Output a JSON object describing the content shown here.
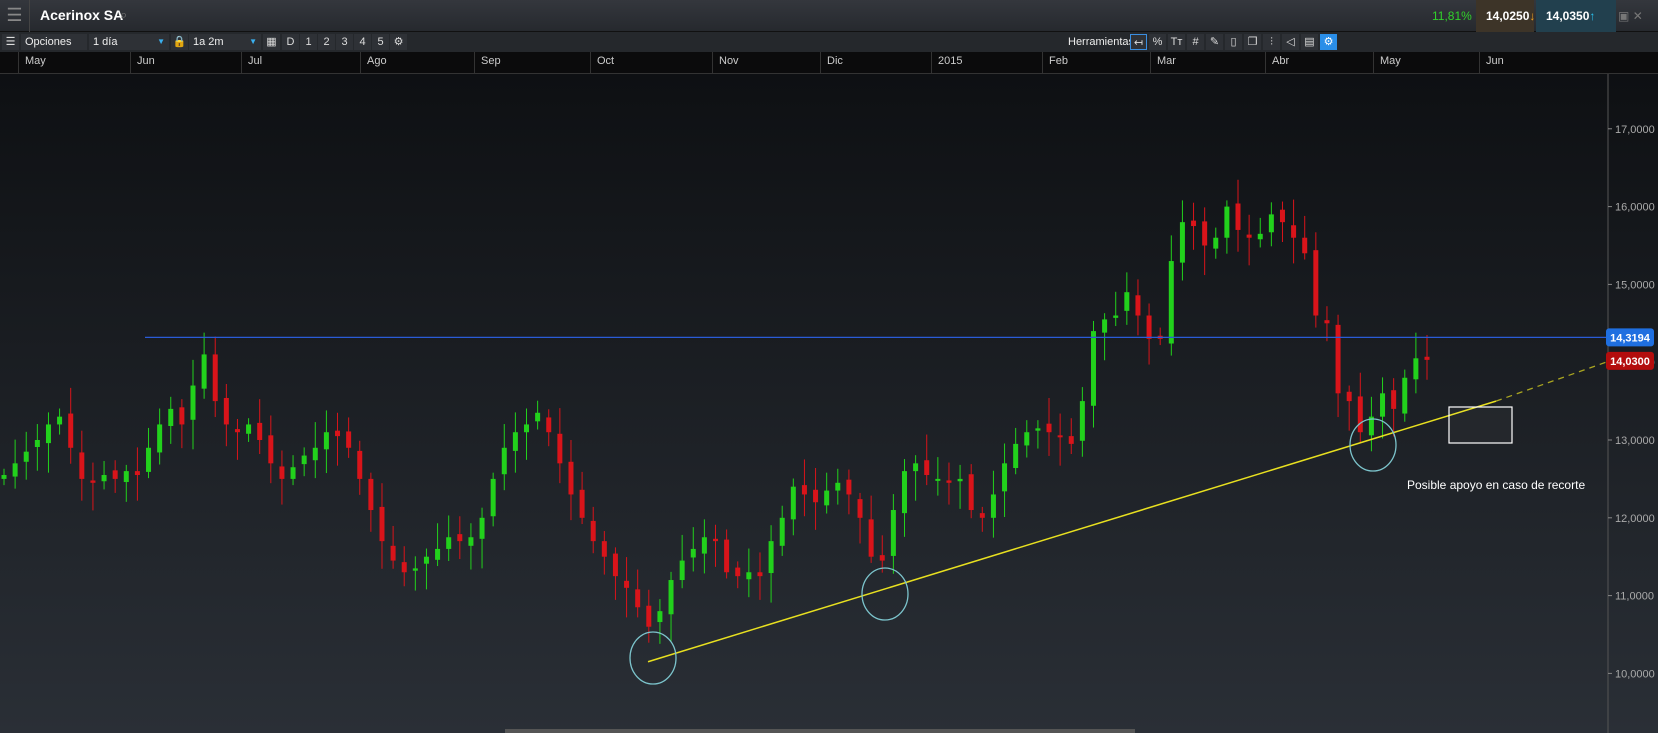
{
  "window": {
    "title": "Acerinox SA",
    "change_pct": "11,81%",
    "bid": "14,0250",
    "ask": "14,0350",
    "icons": [
      "menu-icon",
      "search-icon",
      "bid-down-arrow-icon",
      "ask-up-arrow-icon",
      "restore-icon",
      "close-icon"
    ]
  },
  "toolbar": {
    "options_label": "Opciones",
    "interval": "1 día",
    "range": "1a 2m",
    "periods": [
      "D",
      "1",
      "2",
      "3",
      "4",
      "5"
    ],
    "tools_label": "Herramientas",
    "tool_icons": [
      "back-icon",
      "%",
      "Tт",
      "#",
      "draw-icon",
      "candle-icon",
      "windows-icon",
      "candles-icon",
      "tag-icon",
      "print-icon",
      "settings-draw-icon"
    ]
  },
  "chart_data": {
    "type": "candlestick",
    "x_ticks": [
      "May",
      "Jun",
      "Jul",
      "Ago",
      "Sep",
      "Oct",
      "Nov",
      "Dic",
      "2015",
      "Feb",
      "Mar",
      "Abr",
      "May",
      "Jun"
    ],
    "y_ticks": [
      "10,0000",
      "11,0000",
      "12,0000",
      "13,0000",
      "14,0000",
      "15,0000",
      "16,0000",
      "17,0000"
    ],
    "ylim": [
      9.5,
      18.3
    ],
    "closes": [
      12.55,
      12.7,
      12.85,
      13.0,
      13.2,
      13.3,
      12.9,
      12.5,
      12.45,
      12.55,
      12.5,
      12.6,
      12.55,
      12.9,
      13.2,
      13.4,
      13.2,
      13.7,
      14.1,
      13.5,
      13.2,
      13.1,
      13.2,
      13.0,
      12.7,
      12.5,
      12.65,
      12.8,
      12.9,
      13.1,
      13.05,
      12.9,
      12.5,
      12.1,
      11.7,
      11.45,
      11.3,
      11.35,
      11.5,
      11.6,
      11.75,
      11.7,
      11.75,
      12.0,
      12.5,
      12.9,
      13.1,
      13.2,
      13.35,
      13.1,
      12.7,
      12.3,
      12.0,
      11.7,
      11.5,
      11.25,
      11.1,
      10.85,
      10.6,
      10.8,
      11.2,
      11.45,
      11.6,
      11.75,
      11.7,
      11.3,
      11.25,
      11.3,
      11.25,
      11.7,
      12.0,
      12.4,
      12.3,
      12.2,
      12.35,
      12.45,
      12.3,
      12.0,
      11.5,
      11.45,
      12.1,
      12.6,
      12.7,
      12.55,
      12.5,
      12.45,
      12.5,
      12.1,
      12.0,
      12.3,
      12.7,
      12.95,
      13.1,
      13.15,
      13.1,
      13.05,
      12.95,
      13.5,
      14.4,
      14.55,
      14.6,
      14.9,
      14.6,
      14.3,
      14.3,
      15.3,
      15.8,
      15.75,
      15.5,
      15.6,
      16.0,
      15.7,
      15.6,
      15.65,
      15.9,
      15.8,
      15.6,
      15.4,
      14.6,
      14.5,
      13.6,
      13.5,
      13.1,
      13.3,
      13.6,
      13.4,
      13.8,
      14.05,
      14.03
    ],
    "resistance_level": 14.3194,
    "resistance_label": "14,3194",
    "last_price": 14.03,
    "last_price_label": "14,0300",
    "trendline": {
      "from": 10.15,
      "to": 13.5,
      "extension_to": 14.0
    },
    "annotation": "Posible apoyo en caso de recorte",
    "colors": {
      "up": "#22d11c",
      "down": "#d9141a",
      "resistance": "#2a5bd7",
      "trendline": "#e8e020",
      "circles": "#7cc4cc",
      "last_price_bg": "#b30d0d",
      "resistance_bg": "#1f6fe0"
    }
  }
}
